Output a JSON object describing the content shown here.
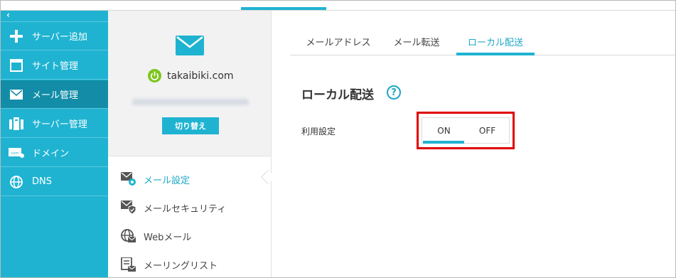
{
  "sidebar": {
    "collapse_glyph": "‹",
    "items": [
      {
        "label": "サーバー追加",
        "icon": "plus-icon"
      },
      {
        "label": "サイト管理",
        "icon": "window-icon"
      },
      {
        "label": "メール管理",
        "icon": "envelope-icon",
        "active": true
      },
      {
        "label": "サーバー管理",
        "icon": "server-icon"
      },
      {
        "label": "ドメイン",
        "icon": "domain-icon"
      },
      {
        "label": "DNS",
        "icon": "globe-icon"
      }
    ]
  },
  "account": {
    "domain": "takaibiki.com",
    "switch_label": "切り替え"
  },
  "submenu": {
    "items": [
      {
        "label": "メール設定",
        "icon": "mail-settings-icon",
        "active": true
      },
      {
        "label": "メールセキュリティ",
        "icon": "mail-security-icon"
      },
      {
        "label": "Webメール",
        "icon": "webmail-icon"
      },
      {
        "label": "メーリングリスト",
        "icon": "mailing-list-icon"
      }
    ]
  },
  "tabs": [
    {
      "label": "メールアドレス"
    },
    {
      "label": "メール転送"
    },
    {
      "label": "ローカル配送",
      "active": true
    }
  ],
  "main": {
    "title": "ローカル配送",
    "help_glyph": "?",
    "setting_label": "利用設定",
    "toggle": {
      "on_label": "ON",
      "off_label": "OFF",
      "selected": "ON"
    }
  },
  "colors": {
    "accent": "#1fb3d1",
    "sidebar_active": "#138da7",
    "highlight": "#e00000",
    "power_green": "#7cc61d"
  }
}
